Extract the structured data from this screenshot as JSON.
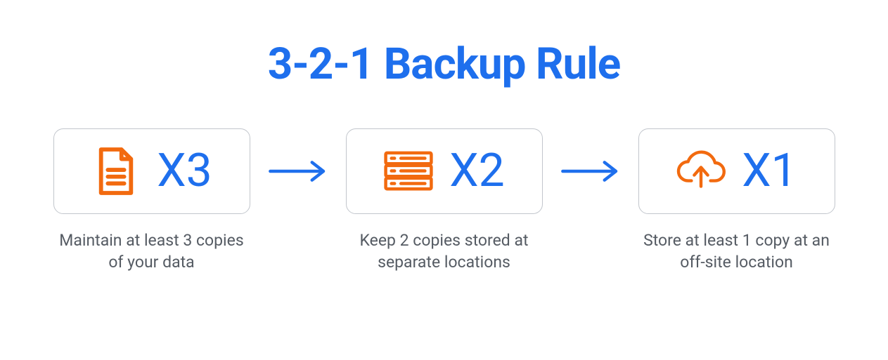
{
  "title": "3-2-1 Backup Rule",
  "colors": {
    "primary": "#1e6fed",
    "accent": "#f26a0f",
    "text": "#555b63",
    "border": "#c2c6cc"
  },
  "steps": [
    {
      "icon": "document-icon",
      "count": "X3",
      "caption": "Maintain at least 3 copies of your data"
    },
    {
      "icon": "server-icon",
      "count": "X2",
      "caption": "Keep 2 copies stored at separate locations"
    },
    {
      "icon": "cloud-upload-icon",
      "count": "X1",
      "caption": "Store at least 1 copy at an off-site location"
    }
  ]
}
